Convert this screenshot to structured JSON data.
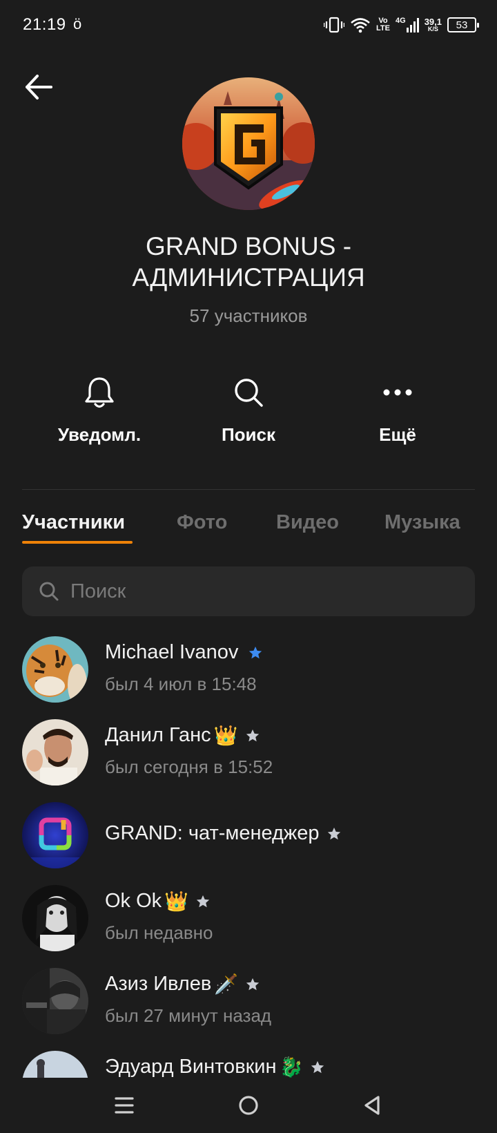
{
  "status_bar": {
    "time": "21:19",
    "left_icon": "ö",
    "volte_top": "Vo",
    "volte_bottom": "LTE",
    "network": "4G",
    "speed_top": "39,1",
    "speed_bottom": "K/S",
    "battery": "53"
  },
  "header": {
    "title": "GRAND BONUS - АДМИНИСТРАЦИЯ",
    "member_count": "57 участников"
  },
  "actions": [
    {
      "label": "Уведомл.",
      "icon": "bell-icon"
    },
    {
      "label": "Поиск",
      "icon": "search-icon"
    },
    {
      "label": "Ещё",
      "icon": "more-icon"
    }
  ],
  "tabs": [
    {
      "label": "Участники",
      "active": true
    },
    {
      "label": "Фото",
      "active": false
    },
    {
      "label": "Видео",
      "active": false
    },
    {
      "label": "Музыка",
      "active": false
    }
  ],
  "search": {
    "placeholder": "Поиск"
  },
  "members": [
    {
      "name": "Michael Ivanov",
      "emoji": "",
      "status": "был 4 июл в 15:48",
      "star_color": "#3d8bf0"
    },
    {
      "name": "Данил Ганс",
      "emoji": "👑",
      "status": "был сегодня в 15:52",
      "star_color": "#c9ccd3"
    },
    {
      "name": "GRAND: чат-менеджер",
      "emoji": "",
      "status": "",
      "star_color": "#c9ccd3"
    },
    {
      "name": "Ok Ok",
      "emoji": "👑",
      "status": "был недавно",
      "star_color": "#c9ccd3"
    },
    {
      "name": "Азиз Ивлев",
      "emoji": "🗡️",
      "status": "был 27 минут назад",
      "star_color": "#c9ccd3"
    },
    {
      "name": "Эдуард Винтовкин",
      "emoji": "🐉",
      "status": "",
      "star_color": "#c9ccd3"
    }
  ],
  "colors": {
    "background": "#1c1c1c",
    "accent": "#ee8208",
    "admin_star_blue": "#3d8bf0",
    "admin_star_gray": "#c9ccd3"
  }
}
